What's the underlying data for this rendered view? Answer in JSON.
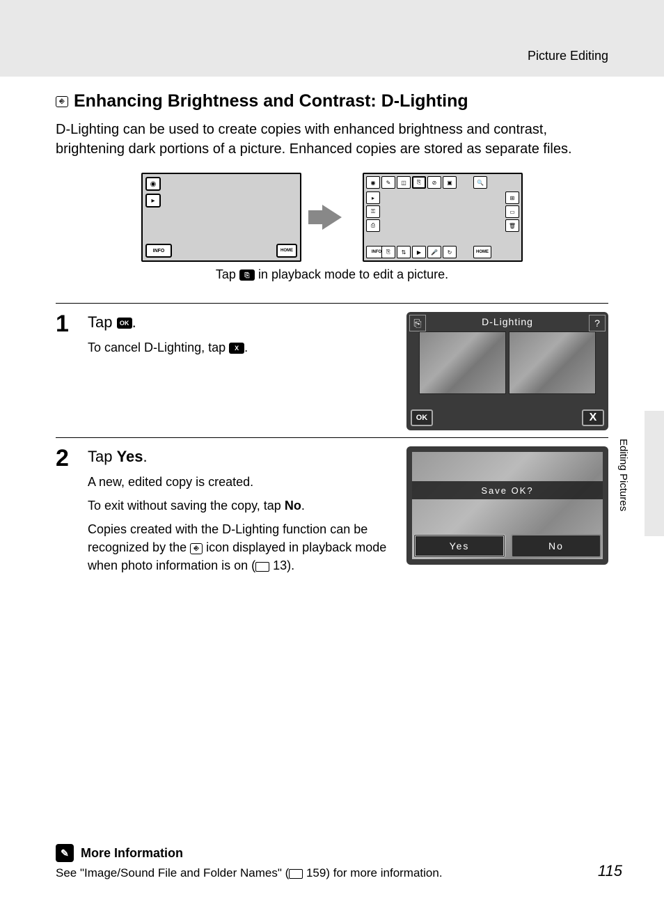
{
  "header": "Picture Editing",
  "title": "Enhancing Brightness and Contrast: D-Lighting",
  "intro": "D-Lighting can be used to create copies with enhanced brightness and contrast, brightening dark portions of a picture. Enhanced copies are stored as separate files.",
  "screen_caption_pre": "Tap ",
  "screen_caption_post": " in playback mode to edit a picture.",
  "steps": [
    {
      "num": "1",
      "head_pre": "Tap ",
      "head_post": ".",
      "lines": [
        {
          "pre": "To cancel D-Lighting, tap ",
          "post": "."
        }
      ],
      "lcd": {
        "title": "D-Lighting",
        "ok": "OK",
        "x": "X",
        "help": "?"
      }
    },
    {
      "num": "2",
      "head_pre": "Tap ",
      "head_bold": "Yes",
      "head_post": ".",
      "lines": [
        {
          "text": "A new, edited copy is created."
        },
        {
          "pre": "To exit without saving the copy, tap ",
          "bold": "No",
          "post": "."
        },
        {
          "pre": "Copies created with the D-Lighting function can be recognized by the ",
          "post": " icon displayed in playback mode when photo information is on (",
          "ref": " 13)."
        }
      ],
      "lcd_save": {
        "prompt": "Save OK?",
        "yes": "Yes",
        "no": "No"
      }
    }
  ],
  "side_tab": "Editing Pictures",
  "more_info": {
    "head": "More Information",
    "text_pre": "See \"Image/Sound File and Folder Names\" (",
    "text_ref": " 159) for more information."
  },
  "page_num": "115",
  "icons": {
    "info": "INFO",
    "home": "HOME",
    "ok_small": "OK",
    "x_small": "X",
    "dlighting_small": "⎘"
  }
}
